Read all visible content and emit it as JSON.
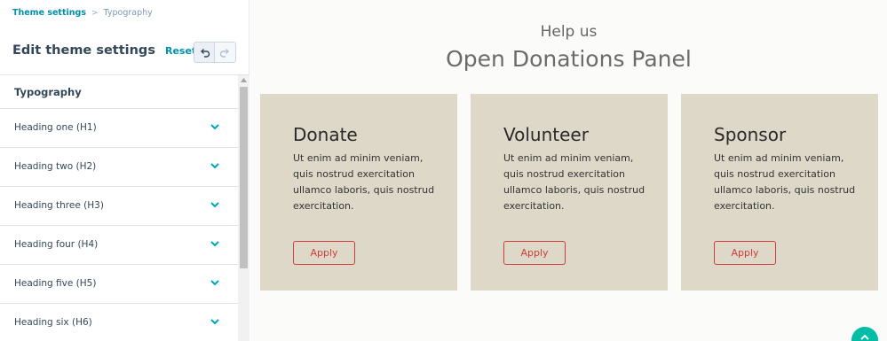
{
  "breadcrumb": {
    "parent": "Theme settings",
    "separator": ">",
    "current": "Typography"
  },
  "panel": {
    "title": "Edit theme settings",
    "reset_label": "Reset"
  },
  "section": {
    "title": "Typography"
  },
  "items": [
    {
      "label": "Heading one (H1)"
    },
    {
      "label": "Heading two (H2)"
    },
    {
      "label": "Heading three (H3)"
    },
    {
      "label": "Heading four (H4)"
    },
    {
      "label": "Heading five (H5)"
    },
    {
      "label": "Heading six (H6)"
    }
  ],
  "preview": {
    "eyebrow": "Help us",
    "headline": "Open Donations Panel",
    "cards": [
      {
        "title": "Donate",
        "body": "Ut enim ad minim veniam, quis nostrud exercitation ullamco laboris, quis nostrud exercitation.",
        "button": "Apply"
      },
      {
        "title": "Volunteer",
        "body": "Ut enim ad minim veniam, quis nostrud exercitation ullamco laboris, quis nostrud exercitation.",
        "button": "Apply"
      },
      {
        "title": "Sponsor",
        "body": "Ut enim ad minim veniam, quis nostrud exercitation ullamco laboris, quis nostrud exercitation.",
        "button": "Apply"
      }
    ]
  },
  "colors": {
    "link": "#0091ae",
    "card_bg": "#ddd8c8",
    "button_accent": "#d13c3c",
    "fab": "#00bda5"
  },
  "icons": {
    "undo": "undo-icon",
    "redo": "redo-icon",
    "chevron": "chevron-down-icon",
    "scroll_up": "chevron-up-icon"
  }
}
